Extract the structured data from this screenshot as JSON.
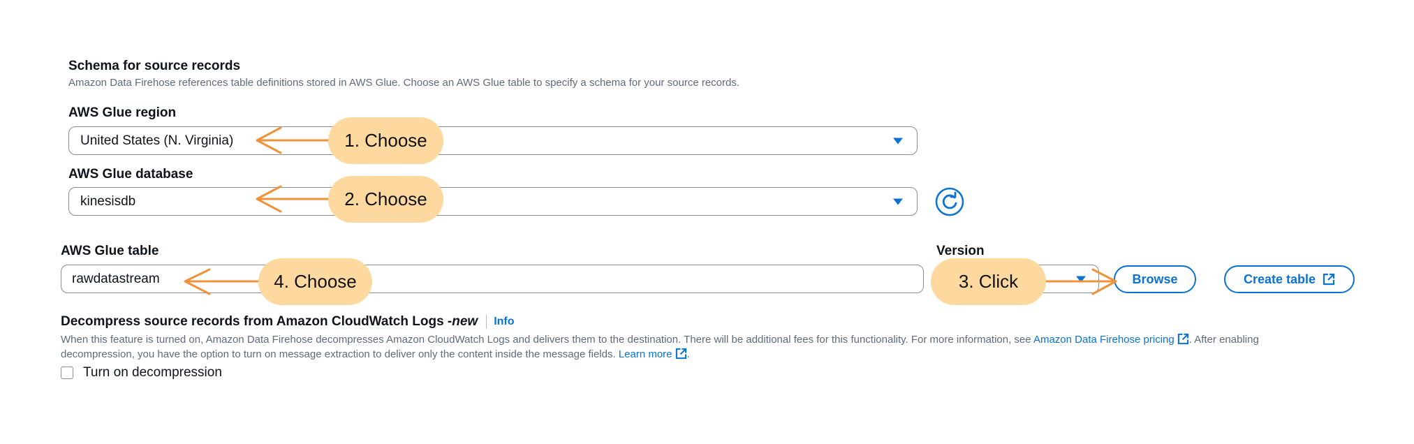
{
  "schema_section": {
    "title": "Schema for source records",
    "description": "Amazon Data Firehose references table definitions stored in AWS Glue. Choose an AWS Glue table to specify a schema for your source records."
  },
  "glue_region": {
    "label": "AWS Glue region",
    "value": "United States (N. Virginia)"
  },
  "glue_database": {
    "label": "AWS Glue database",
    "value": "kinesisdb"
  },
  "glue_table": {
    "label": "AWS Glue table",
    "value": "rawdatastream"
  },
  "version": {
    "label": "Version"
  },
  "buttons": {
    "browse": "Browse",
    "create_table": "Create table"
  },
  "decompress": {
    "title": "Decompress source records from Amazon CloudWatch Logs - ",
    "title_new": "new",
    "info": "Info",
    "desc_part1": "When this feature is turned on, Amazon Data Firehose decompresses Amazon CloudWatch Logs and delivers them to the destination. There will be additional fees for this functionality. For more information, see ",
    "pricing_link": "Amazon Data Firehose pricing",
    "desc_part2": ". After enabling",
    "desc_line2": "decompression, you have the option to turn on message extraction to deliver only the content inside the message fields. ",
    "learn_more": "Learn more",
    "desc_end": ".",
    "checkbox_label": "Turn on decompression"
  },
  "annotations": {
    "step1": "1. Choose",
    "step2": "2. Choose",
    "step3": "3. Click",
    "step4": "4. Choose",
    "color": "#fdd9a0",
    "arrow_color": "#f0923a"
  },
  "colors": {
    "accent": "#0972d3",
    "border": "#8c8c94"
  }
}
